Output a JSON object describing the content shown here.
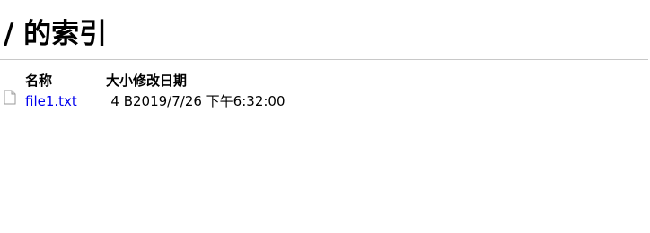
{
  "page": {
    "title": "/ 的索引"
  },
  "listing": {
    "headers": {
      "name": "名称",
      "size": "大小",
      "modified": "修改日期"
    },
    "files": [
      {
        "icon": "file-icon",
        "name": "file1.txt",
        "size": "4 B",
        "modified": "2019/7/26 下午6:32:00"
      }
    ]
  },
  "colors": {
    "link": "#0000ee",
    "rule": "#c8c8c8"
  }
}
